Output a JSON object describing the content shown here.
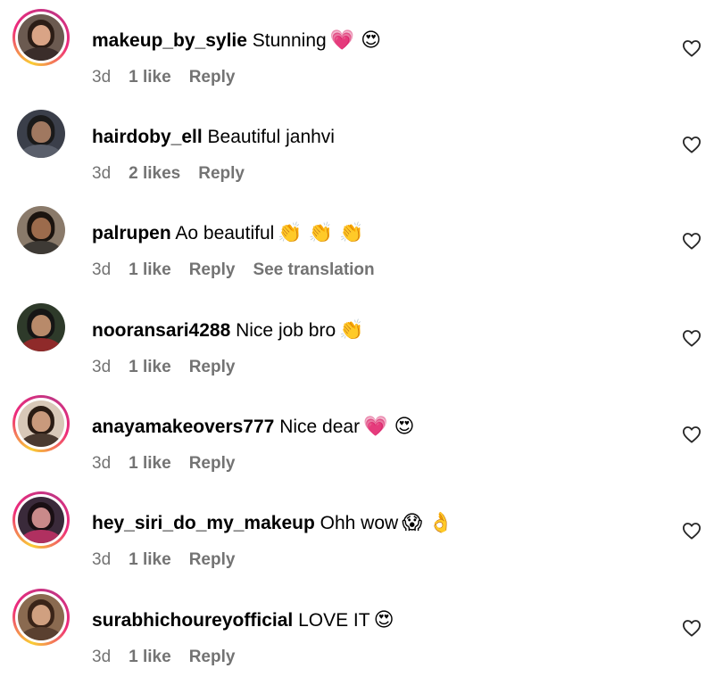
{
  "comments": [
    {
      "username": "makeup_by_sylie",
      "text": "Stunning",
      "emoji": "💗 😍",
      "time": "3d",
      "likes": "1 like",
      "reply": "Reply",
      "translation": "",
      "avatar_colors": {
        "bg": "#6b5a50",
        "hair": "#2b1d16",
        "skin": "#d9a486",
        "top": "#3a2d2a"
      },
      "story_ring": true
    },
    {
      "username": "hairdoby_ell",
      "text": "Beautiful janhvi",
      "emoji": "",
      "time": "3d",
      "likes": "2 likes",
      "reply": "Reply",
      "translation": "",
      "avatar_colors": {
        "bg": "#3b3f4a",
        "hair": "#1a1a1a",
        "skin": "#a07860",
        "top": "#5a5f6b"
      },
      "story_ring": false
    },
    {
      "username": "palrupen",
      "text": "Ao beautiful",
      "emoji": "👏 👏 👏",
      "time": "3d",
      "likes": "1 like",
      "reply": "Reply",
      "translation": "See translation",
      "avatar_colors": {
        "bg": "#8a7a6a",
        "hair": "#1b140f",
        "skin": "#9c6b4c",
        "top": "#3e3a35"
      },
      "story_ring": false
    },
    {
      "username": "nooransari4288",
      "text": "Nice job bro",
      "emoji": "👏",
      "time": "3d",
      "likes": "1 like",
      "reply": "Reply",
      "translation": "",
      "avatar_colors": {
        "bg": "#2e3a2a",
        "hair": "#151515",
        "skin": "#b88a6a",
        "top": "#8f2a2a"
      },
      "story_ring": false
    },
    {
      "username": "anayamakeovers777",
      "text": "Nice dear",
      "emoji": "💗 😍",
      "time": "3d",
      "likes": "1 like",
      "reply": "Reply",
      "translation": "",
      "avatar_colors": {
        "bg": "#d8c8b8",
        "hair": "#2a1c14",
        "skin": "#c99a7c",
        "top": "#4a3a30"
      },
      "story_ring": true
    },
    {
      "username": "hey_siri_do_my_makeup",
      "text": "Ohh wow",
      "emoji": "😱 👌",
      "time": "3d",
      "likes": "1 like",
      "reply": "Reply",
      "translation": "",
      "avatar_colors": {
        "bg": "#3a2a3a",
        "hair": "#1a0f14",
        "skin": "#c98a8a",
        "top": "#b03060"
      },
      "story_ring": true
    },
    {
      "username": "surabhichoureyofficial",
      "text": "LOVE IT",
      "emoji": "😍",
      "time": "3d",
      "likes": "1 like",
      "reply": "Reply",
      "translation": "",
      "avatar_colors": {
        "bg": "#8a6a50",
        "hair": "#3a2418",
        "skin": "#d0a080",
        "top": "#5a4030"
      },
      "story_ring": true
    }
  ],
  "icons": {
    "like": "heart-outline-icon"
  },
  "colors": {
    "meta_text": "#737373",
    "story_ring_start": "#f9ce34",
    "story_ring_end": "#ee2a7b"
  }
}
